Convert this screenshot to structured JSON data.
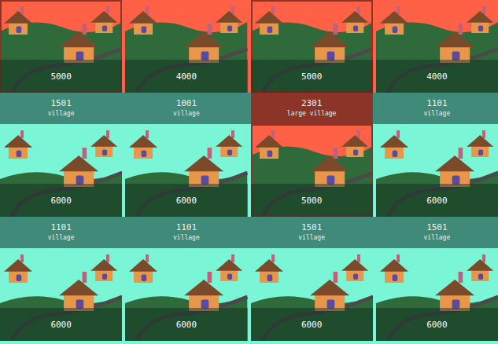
{
  "rows": [
    {
      "tiles": [
        {
          "cost": "5000",
          "level": "1501",
          "name": "village",
          "locked": true,
          "selected": false,
          "outlined": true
        },
        {
          "cost": "4000",
          "level": "1001",
          "name": "village",
          "locked": true,
          "selected": false,
          "outlined": false
        },
        {
          "cost": "5000",
          "level": "2301",
          "name": "large village",
          "locked": true,
          "selected": true,
          "outlined": true
        },
        {
          "cost": "4000",
          "level": "1101",
          "name": "village",
          "locked": true,
          "selected": false,
          "outlined": false
        }
      ]
    },
    {
      "tiles": [
        {
          "cost": "6000",
          "level": "1101",
          "name": "village",
          "locked": false,
          "selected": false,
          "outlined": false
        },
        {
          "cost": "6000",
          "level": "1101",
          "name": "village",
          "locked": false,
          "selected": false,
          "outlined": false
        },
        {
          "cost": "5000",
          "level": "1501",
          "name": "village",
          "locked": true,
          "selected": false,
          "outlined": true
        },
        {
          "cost": "6000",
          "level": "1501",
          "name": "village",
          "locked": false,
          "selected": false,
          "outlined": false
        }
      ]
    },
    {
      "tiles": [
        {
          "cost": "6000",
          "locked": false,
          "selected": false,
          "outlined": false
        },
        {
          "cost": "6000",
          "locked": false,
          "selected": false,
          "outlined": false
        },
        {
          "cost": "6000",
          "locked": false,
          "selected": false,
          "outlined": false
        },
        {
          "cost": "6000",
          "locked": false,
          "selected": false,
          "outlined": false
        }
      ]
    }
  ]
}
